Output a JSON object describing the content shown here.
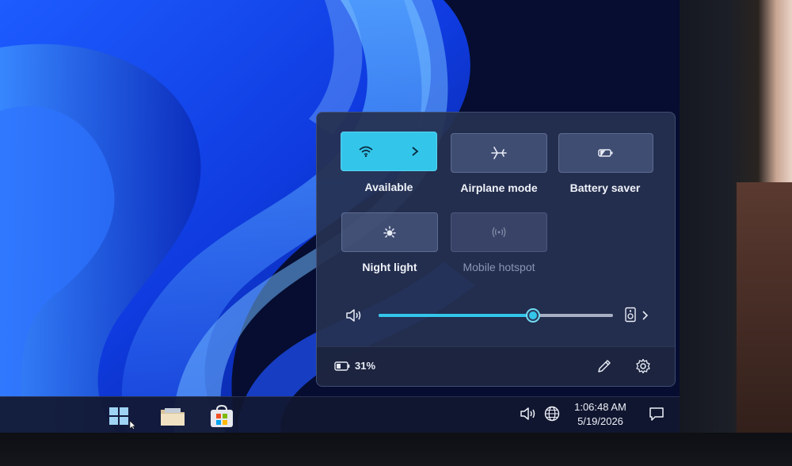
{
  "quick_settings": {
    "tiles": [
      {
        "label": "Available",
        "icon": "wifi-icon",
        "active": true,
        "has_chevron": true
      },
      {
        "label": "Airplane mode",
        "icon": "airplane-icon",
        "active": false
      },
      {
        "label": "Battery saver",
        "icon": "battery-saver-icon",
        "active": false
      },
      {
        "label": "Night light",
        "icon": "night-light-icon",
        "active": false
      },
      {
        "label": "Mobile hotspot",
        "icon": "mobile-hotspot-icon",
        "active": false,
        "disabled": true
      }
    ],
    "volume": {
      "level": 0.66,
      "icon": "speaker-icon",
      "output_icon": "audio-output-icon"
    },
    "footer": {
      "battery_text": "31%",
      "battery_icon": "battery-icon",
      "edit_icon": "pencil-icon",
      "settings_icon": "gear-icon"
    }
  },
  "taskbar": {
    "apps": [
      {
        "name": "start",
        "icon": "windows-start-icon"
      },
      {
        "name": "file-explorer",
        "icon": "folder-icon"
      },
      {
        "name": "store",
        "icon": "store-icon"
      }
    ],
    "tray": {
      "volume_icon": "speaker-icon",
      "network_icon": "globe-icon",
      "time": "1:06:48 AM",
      "date": "5/19/2026",
      "notifications_icon": "notification-icon"
    }
  },
  "colors": {
    "accent": "#33c6ea",
    "flyout_bg": "#263050",
    "tile_bg": "#5a6891",
    "taskbar_bg": "#121830"
  }
}
